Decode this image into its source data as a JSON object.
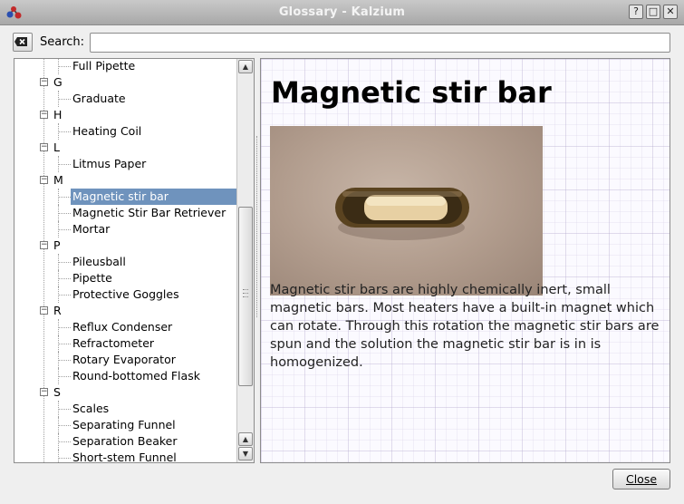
{
  "window": {
    "title": "Glossary - Kalzium",
    "buttons": [
      "?",
      "□",
      "✕"
    ]
  },
  "search": {
    "label": "Search:",
    "value": "",
    "placeholder": ""
  },
  "tree": {
    "rows": [
      {
        "kind": "item",
        "text": "Full Pipette"
      },
      {
        "kind": "group",
        "text": "G"
      },
      {
        "kind": "item",
        "text": "Graduate"
      },
      {
        "kind": "group",
        "text": "H"
      },
      {
        "kind": "item",
        "text": "Heating Coil"
      },
      {
        "kind": "group",
        "text": "L"
      },
      {
        "kind": "item",
        "text": "Litmus Paper"
      },
      {
        "kind": "group",
        "text": "M"
      },
      {
        "kind": "item",
        "text": "Magnetic stir bar",
        "selected": true
      },
      {
        "kind": "item",
        "text": "Magnetic Stir Bar Retriever"
      },
      {
        "kind": "item",
        "text": "Mortar"
      },
      {
        "kind": "group",
        "text": "P"
      },
      {
        "kind": "item",
        "text": "Pileusball"
      },
      {
        "kind": "item",
        "text": "Pipette"
      },
      {
        "kind": "item",
        "text": "Protective Goggles"
      },
      {
        "kind": "group",
        "text": "R"
      },
      {
        "kind": "item",
        "text": "Reflux Condenser"
      },
      {
        "kind": "item",
        "text": "Refractometer"
      },
      {
        "kind": "item",
        "text": "Rotary Evaporator"
      },
      {
        "kind": "item",
        "text": "Round-bottomed Flask"
      },
      {
        "kind": "group",
        "text": "S"
      },
      {
        "kind": "item",
        "text": "Scales"
      },
      {
        "kind": "item",
        "text": "Separating Funnel"
      },
      {
        "kind": "item",
        "text": "Separation Beaker"
      },
      {
        "kind": "item",
        "text": "Short-stem Funnel"
      }
    ]
  },
  "content": {
    "title": "Magnetic stir bar",
    "body": "Magnetic stir bars are highly chemically inert, small magnetic bars. Most heaters have a built-in magnet which can rotate. Through this rotation the magnetic stir bars are spun and the solution the magnetic stir bar is in is homogenized."
  },
  "footer": {
    "close_label": "Close"
  },
  "colors": {
    "selection": "#6f93bd",
    "titlebar": "#b4b4b4"
  }
}
